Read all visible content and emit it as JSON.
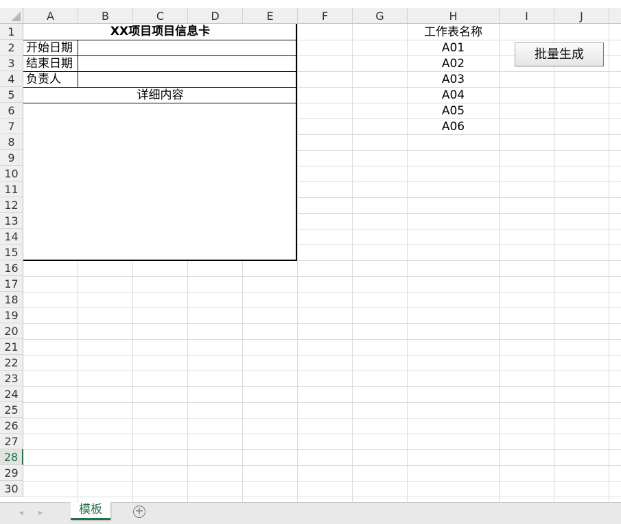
{
  "columns": [
    "A",
    "B",
    "C",
    "D",
    "E",
    "F",
    "G",
    "H",
    "I",
    "J"
  ],
  "rows": [
    "1",
    "2",
    "3",
    "4",
    "5",
    "6",
    "7",
    "8",
    "9",
    "10",
    "11",
    "12",
    "13",
    "14",
    "15",
    "16",
    "17",
    "18",
    "19",
    "20",
    "21",
    "22",
    "23",
    "24",
    "25",
    "26",
    "27",
    "28",
    "29",
    "30"
  ],
  "active_row": "28",
  "card": {
    "title": "XX项目项目信息卡",
    "start_date_label": "开始日期",
    "end_date_label": "结束日期",
    "owner_label": "负责人",
    "details_label": "详细内容"
  },
  "sheet_names": {
    "header": "工作表名称",
    "items": [
      "A01",
      "A02",
      "A03",
      "A04",
      "A05",
      "A06"
    ]
  },
  "button": {
    "label": "批量生成"
  },
  "tabs": {
    "active_sheet": "模板",
    "add_icon": "+",
    "prev_icon": "◂",
    "next_icon": "▸"
  },
  "colors": {
    "accent": "#217346",
    "grid": "#d9d9d9",
    "header_bg": "#efefef"
  }
}
